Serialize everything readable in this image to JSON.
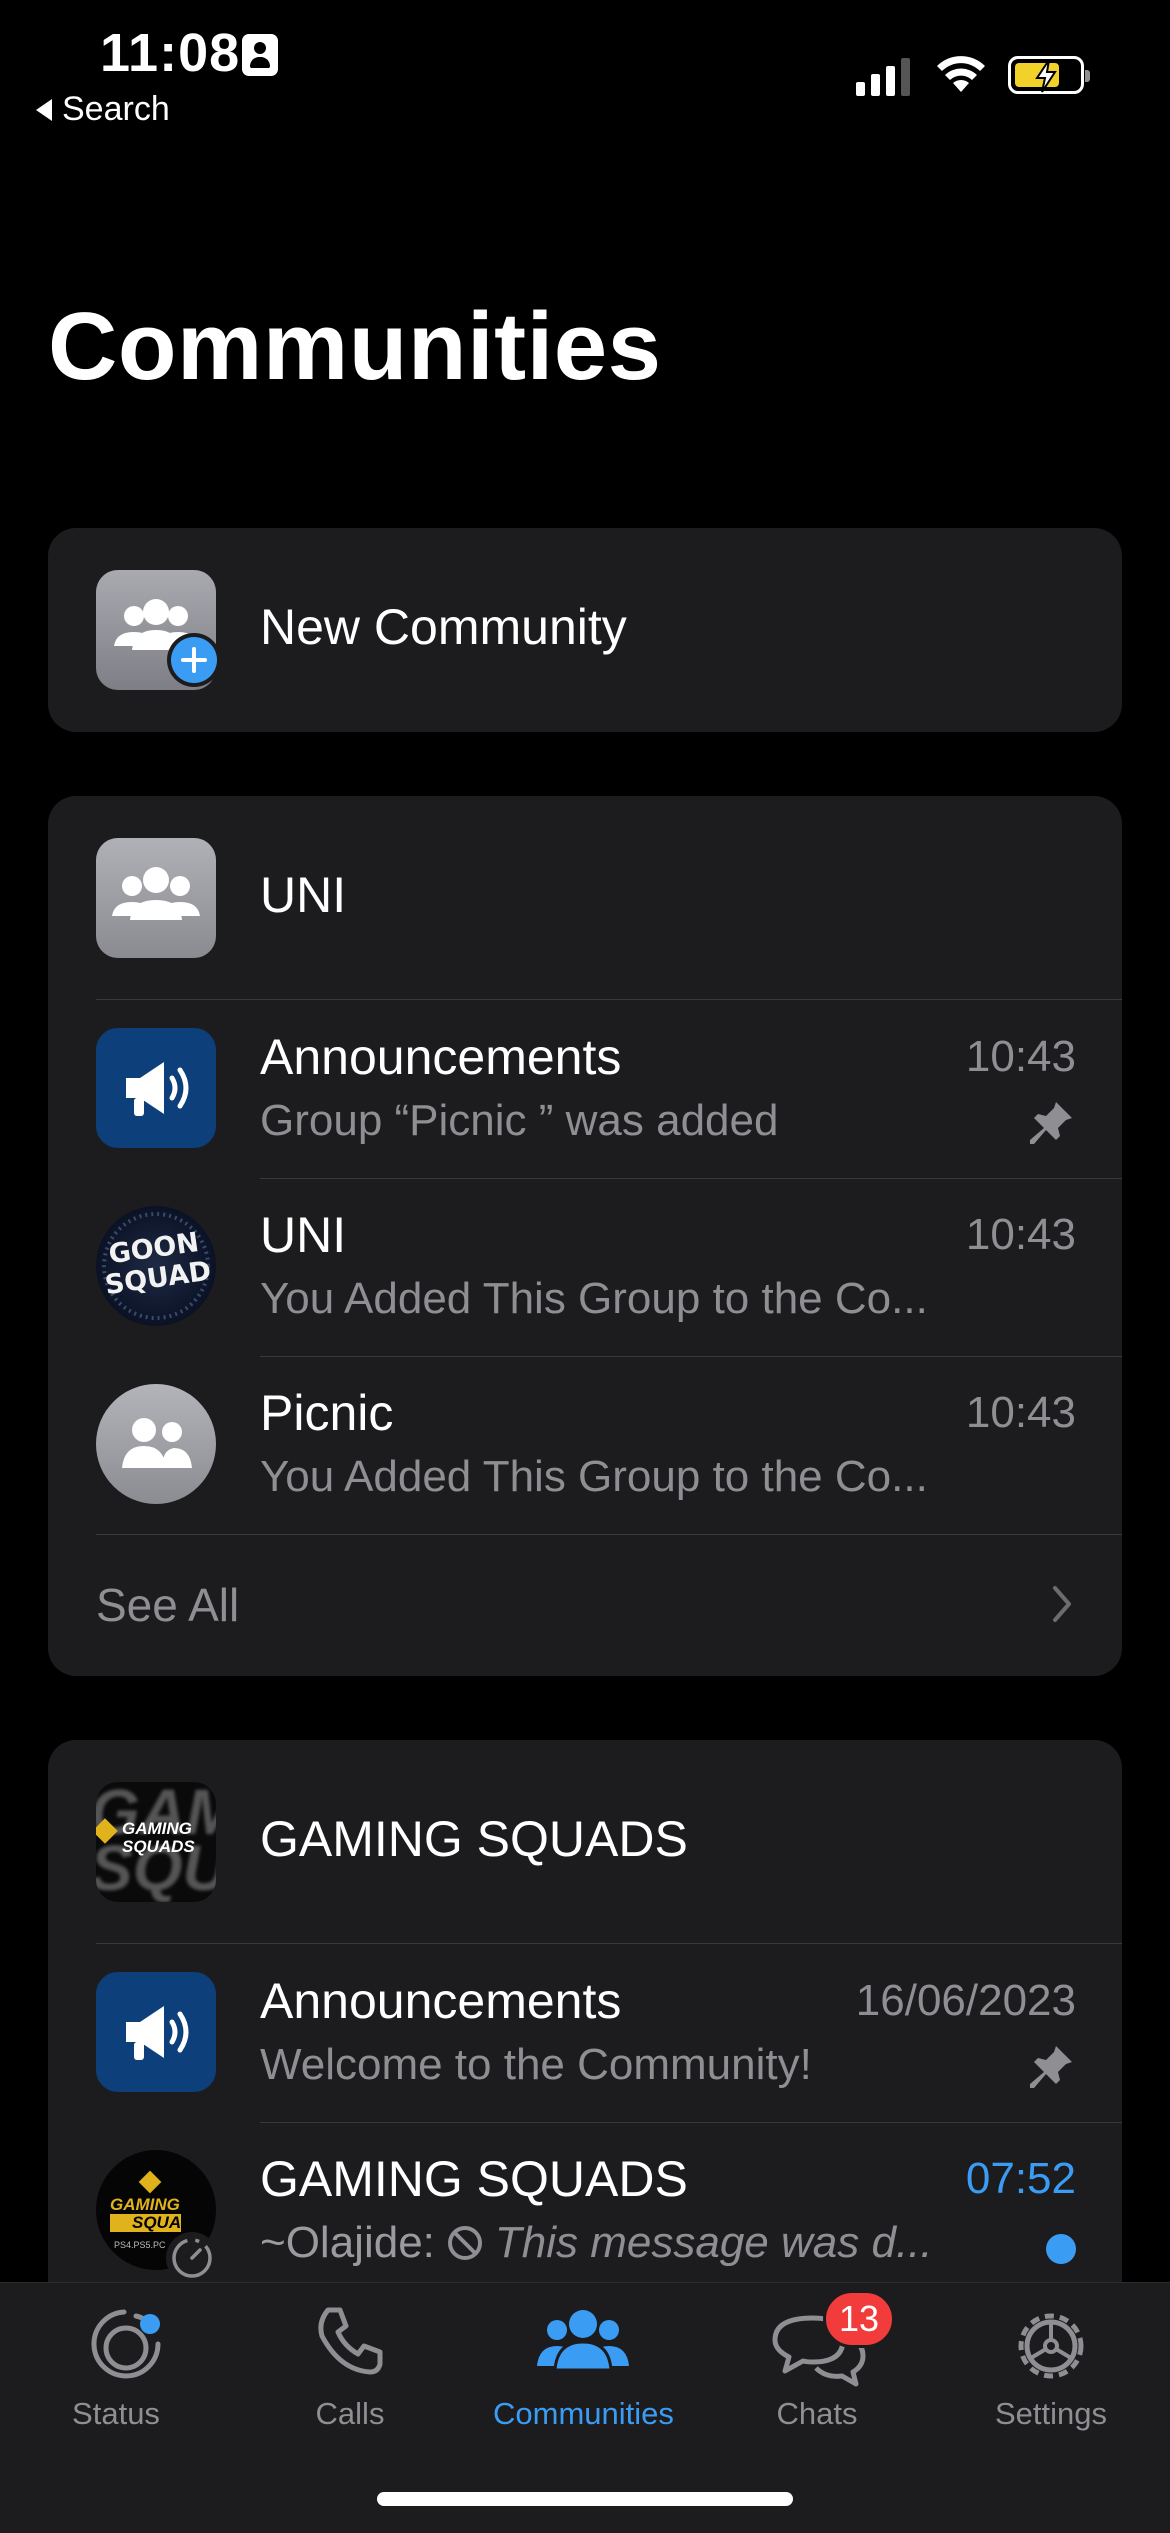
{
  "status_bar": {
    "time": "11:08",
    "back_label": "Search"
  },
  "page_title": "Communities",
  "new_community": {
    "label": "New Community"
  },
  "communities": [
    {
      "name": "UNI",
      "groups": [
        {
          "name": "Announcements",
          "preview": "Group “Picnic ” was added",
          "time": "10:43",
          "pinned": true
        },
        {
          "name": "UNI",
          "preview": "You Added This Group to the Co...",
          "time": "10:43"
        },
        {
          "name": "Picnic",
          "preview": "You Added This Group to the Co...",
          "time": "10:43"
        }
      ],
      "see_all": "See All"
    },
    {
      "name": "GAMING SQUADS",
      "groups": [
        {
          "name": "Announcements",
          "preview": "Welcome to the Community!",
          "time": "16/06/2023",
          "pinned": true
        },
        {
          "name": "GAMING SQUADS",
          "sender": "~Olajide:",
          "preview": "This message was d...",
          "time": "07:52",
          "unread": true
        }
      ]
    }
  ],
  "avatar_text": {
    "uni_logo_top": "GOON",
    "uni_logo_bottom": "SQUAD",
    "gaming_logo_1": "GAMING",
    "gaming_logo_2": "SQUADS",
    "gaming_logo_3": "SQUA",
    "gaming_logo_4": "PS4.PS5.PC"
  },
  "tab_bar": {
    "tabs": [
      {
        "label": "Status",
        "icon": "status-icon"
      },
      {
        "label": "Calls",
        "icon": "phone-icon"
      },
      {
        "label": "Communities",
        "icon": "communities-icon",
        "active": true
      },
      {
        "label": "Chats",
        "icon": "chats-icon",
        "badge": "13"
      },
      {
        "label": "Settings",
        "icon": "gear-icon"
      }
    ]
  },
  "colors": {
    "accent": "#3b9cf3",
    "badge": "#f23c3c",
    "card": "#1c1c1e",
    "secondary_text": "#8e8e93"
  }
}
